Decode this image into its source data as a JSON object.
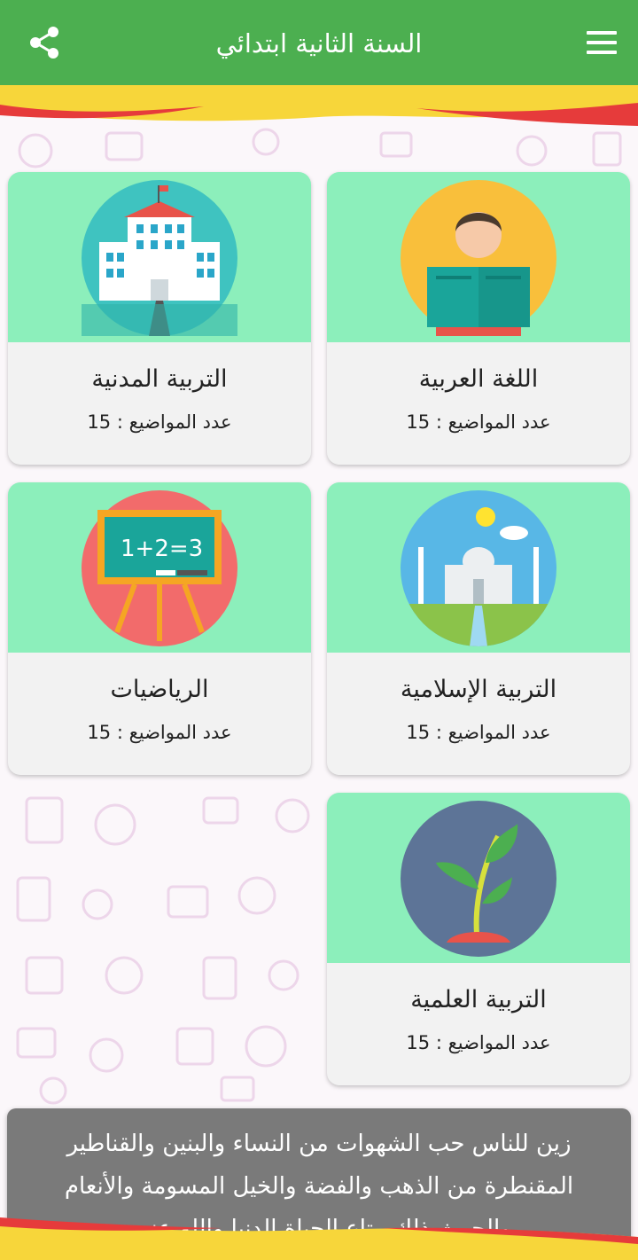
{
  "app": {
    "title": "السنة الثانية ابتدائي",
    "share_icon": "share-icon",
    "menu_icon": "menu-icon",
    "colors": {
      "appbar": "#4caf50",
      "card_header": "#8cefbb",
      "card_body": "#f2f2f2"
    }
  },
  "subjects": [
    {
      "name": "اللغة العربية",
      "count": "عدد المواضيع : 15",
      "icon": "reading-student-icon"
    },
    {
      "name": "التربية المدنية",
      "count": "عدد المواضيع : 15",
      "icon": "school-building-icon"
    },
    {
      "name": "التربية الإسلامية",
      "count": "عدد المواضيع : 15",
      "icon": "mosque-icon"
    },
    {
      "name": "الرياضيات",
      "count": "عدد المواضيع : 15",
      "icon": "chalkboard-math-icon"
    },
    {
      "name": "التربية العلمية",
      "count": "عدد المواضيع : 15",
      "icon": "plant-icon"
    }
  ],
  "quote": {
    "text": "زين للناس حب الشهوات من النساء والبنين والقناطير المقنطرة من الذهب والفضة والخيل المسومة والأنعام والحرث ذلك متاع الحياة الدنيا والله عنده"
  }
}
